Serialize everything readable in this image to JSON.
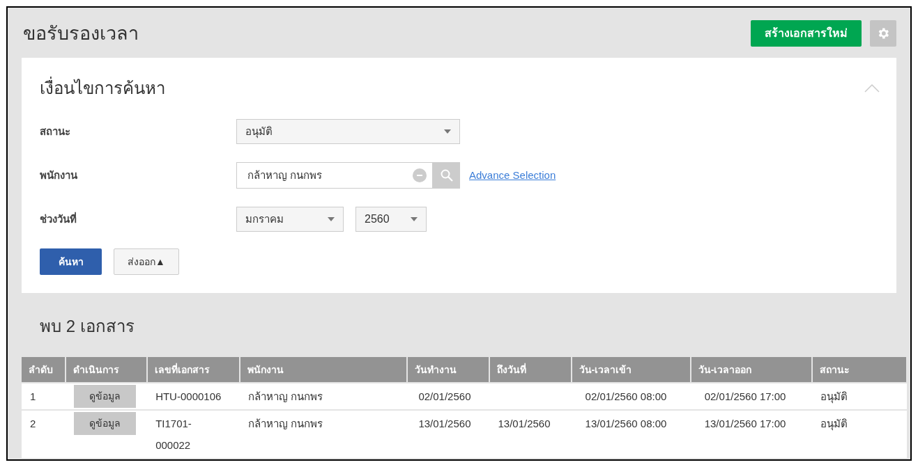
{
  "page_title": "ขอรับรองเวลา",
  "header_buttons": {
    "create": "สร้างเอกสารใหม่"
  },
  "search_panel": {
    "title": "เงื่อนไขการค้นหา",
    "expanded": true,
    "status": {
      "label": "สถานะ",
      "value": "อนุมัติ"
    },
    "employee": {
      "label": "พนักงาน",
      "value": "กล้าหาญ กนกพร",
      "link": "Advance Selection"
    },
    "date_range": {
      "label": "ช่วงวันที่",
      "month": "มกราคม",
      "year": "2560"
    },
    "search_button": "ค้นหา",
    "export_button": "ส่งออก▲"
  },
  "results_title": "พบ 2 เอกสาร",
  "table": {
    "columns": [
      "ลำดับ",
      "ดำเนินการ",
      "เลขที่เอกสาร",
      "พนักงาน",
      "วันทำงาน",
      "ถึงวันที่",
      "วัน-เวลาเข้า",
      "วัน-เวลาออก",
      "สถานะ"
    ],
    "rows": [
      {
        "no": "1",
        "action": "ดูข้อมูล",
        "doc_no": [
          "HTU-0000106"
        ],
        "employee": "กล้าหาญ กนกพร",
        "work_date": "02/01/2560",
        "to_date": "",
        "time_in": "02/01/2560 08:00",
        "time_out": "02/01/2560 17:00",
        "status": "อนุมัติ"
      },
      {
        "no": "2",
        "action": "ดูข้อมูล",
        "doc_no": [
          "TI1701-",
          "000022"
        ],
        "employee": "กล้าหาญ กนกพร",
        "work_date": "13/01/2560",
        "to_date": "13/01/2560",
        "time_in": "13/01/2560 08:00",
        "time_out": "13/01/2560 17:00",
        "status": "อนุมัติ"
      }
    ]
  }
}
